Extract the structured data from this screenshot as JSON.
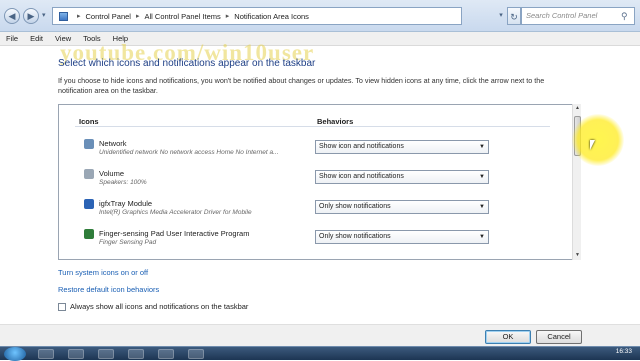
{
  "address": {
    "crumbs": [
      "Control Panel",
      "All Control Panel Items",
      "Notification Area Icons"
    ],
    "search_placeholder": "Search Control Panel"
  },
  "menu": [
    "File",
    "Edit",
    "View",
    "Tools",
    "Help"
  ],
  "watermark": "youtube.com/win10user",
  "heading": "Select which icons and notifications appear on the taskbar",
  "description": "If you choose to hide icons and notifications, you won't be notified about changes or updates. To view hidden icons at any time, click the arrow next to the notification area on the taskbar.",
  "columns": {
    "icons": "Icons",
    "behaviors": "Behaviors"
  },
  "rows": [
    {
      "name": "Network",
      "sub": "Unidentified network No network access Home No Internet a...",
      "behavior": "Show icon and notifications",
      "icon_color": "#6a8fb8"
    },
    {
      "name": "Volume",
      "sub": "Speakers: 100%",
      "behavior": "Show icon and notifications",
      "icon_color": "#9aa7b5"
    },
    {
      "name": "igfxTray Module",
      "sub": "Intel(R) Graphics Media Accelerator Driver for Mobile",
      "behavior": "Only show notifications",
      "icon_color": "#2b63b5"
    },
    {
      "name": "Finger-sensing Pad User Interactive Program",
      "sub": "Finger Sensing Pad",
      "behavior": "Only show notifications",
      "icon_color": "#2f7d3a"
    }
  ],
  "links": {
    "system_icons": "Turn system icons on or off",
    "restore": "Restore default icon behaviors"
  },
  "always_show_label": "Always show all icons and notifications on the taskbar",
  "buttons": {
    "ok": "OK",
    "cancel": "Cancel"
  },
  "taskbar": {
    "time": "16:33"
  }
}
